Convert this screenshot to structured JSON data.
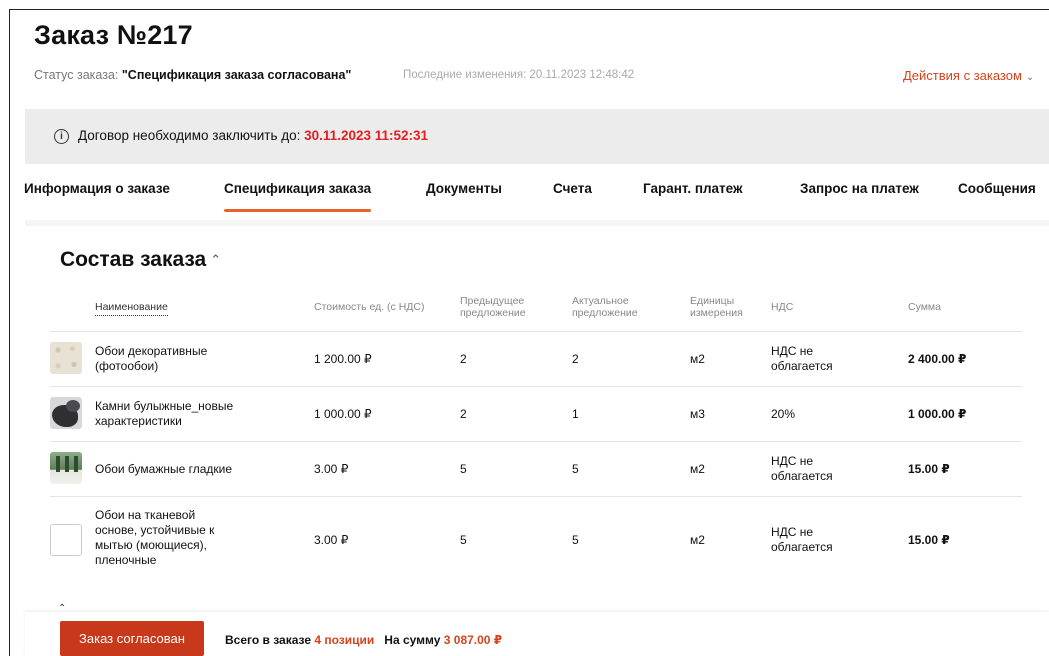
{
  "order": {
    "title": "Заказ №217",
    "status_label": "Статус заказа:",
    "status_value": "\"Спецификация заказа согласована\"",
    "last_change": "Последние изменения: 20.11.2023 12:48:42",
    "actions_label": "Действия с заказом"
  },
  "notice": {
    "icon": "info-icon",
    "text": "Договор необходимо заключить до:",
    "deadline": "30.11.2023 11:52:31",
    "deadline_color": "#e31e1e"
  },
  "tabs": [
    {
      "label": "Информация о заказе",
      "active": false
    },
    {
      "label": "Спецификация заказа",
      "active": true
    },
    {
      "label": "Документы",
      "active": false
    },
    {
      "label": "Счета",
      "active": false
    },
    {
      "label": "Гарант. платеж",
      "active": false
    },
    {
      "label": "Запрос на платеж",
      "active": false
    },
    {
      "label": "Сообщения",
      "active": false
    }
  ],
  "section": {
    "title": "Состав заказа",
    "caret": "^"
  },
  "table": {
    "headers": {
      "name": "Наименование",
      "unit_price": "Стоимость ед. (с НДС)",
      "previous_1": "Предыдущее",
      "previous_2": "предложение",
      "actual_1": "Актуальное",
      "actual_2": "предложение",
      "units_1": "Единицы",
      "units_2": "измерения",
      "vat": "НДС",
      "sum": "Сумма"
    },
    "rows": [
      {
        "thumb": "wallpaper-thumbnail",
        "name_1": "Обои декоративные",
        "name_2": "(фотообои)",
        "name_3": "",
        "name_4": "",
        "unit_price": "1 200.00 ₽",
        "previous": "2",
        "actual": "2",
        "units": "м2",
        "vat_1": "НДС не",
        "vat_2": "облагается",
        "sum": "2 400.00 ₽"
      },
      {
        "thumb": "stones-thumbnail",
        "name_1": "Камни булыжные_новые",
        "name_2": "характеристики",
        "name_3": "",
        "name_4": "",
        "unit_price": "1 000.00 ₽",
        "previous": "2",
        "actual": "1",
        "units": "м3",
        "vat_1": "20%",
        "vat_2": "",
        "sum": "1 000.00 ₽"
      },
      {
        "thumb": "forest-wallpaper-thumbnail",
        "name_1": "Обои бумажные гладкие",
        "name_2": "",
        "name_3": "",
        "name_4": "",
        "unit_price": "3.00 ₽",
        "previous": "5",
        "actual": "5",
        "units": "м2",
        "vat_1": "НДС не",
        "vat_2": "облагается",
        "sum": "15.00 ₽"
      },
      {
        "thumb": "empty-thumbnail",
        "name_1": "Обои на тканевой",
        "name_2": "основе, устойчивые к",
        "name_3": "мытью (моющиеся),",
        "name_4": "пленочные",
        "unit_price": "3.00 ₽",
        "previous": "5",
        "actual": "5",
        "units": "м2",
        "vat_1": "НДС не",
        "vat_2": "облагается",
        "sum": "15.00 ₽"
      }
    ]
  },
  "footer": {
    "button_label": "Заказ согласован",
    "total_label": "Всего в заказе",
    "positions": "4 позиции",
    "sum_label": "На сумму",
    "sum_value": "3 087.00 ₽"
  },
  "colors": {
    "accent": "#d4441c",
    "button": "#c8381a",
    "tab_underline": "#e8632a"
  }
}
